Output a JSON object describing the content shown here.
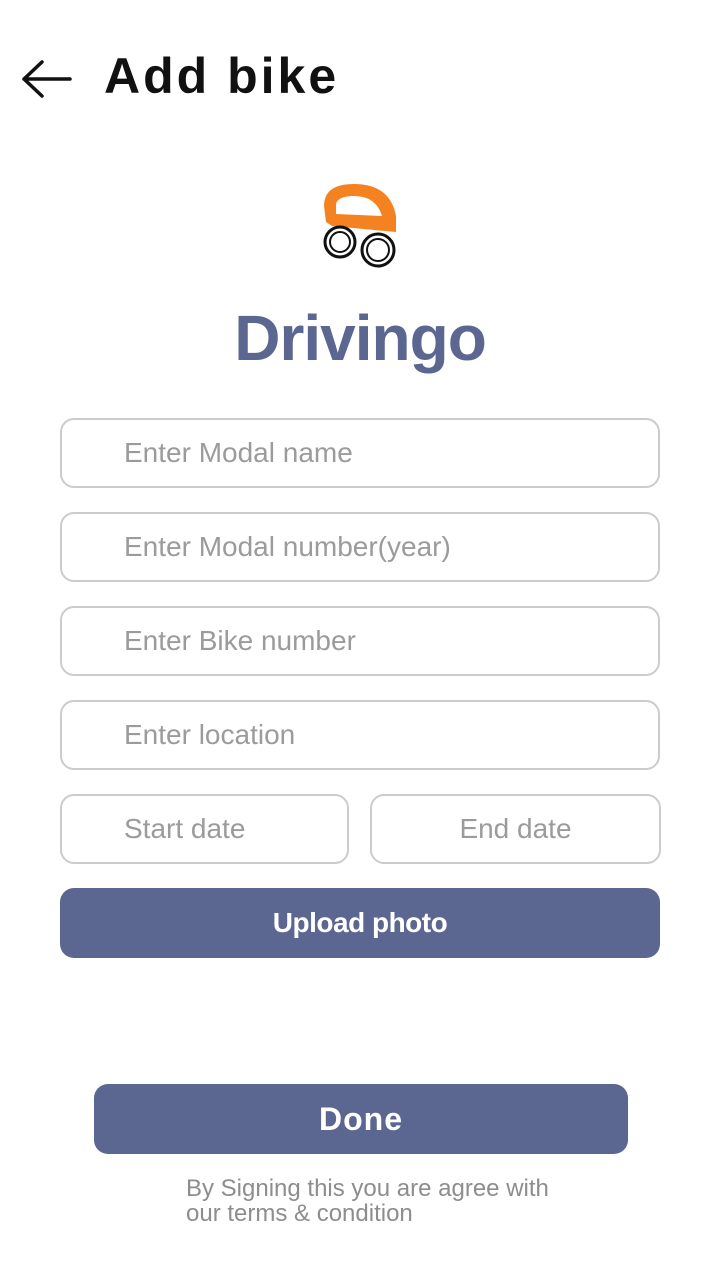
{
  "header": {
    "back_icon": "arrow-left-icon",
    "title": "Add bike"
  },
  "brand": {
    "logo_icon": "car-logo-icon",
    "name": "Drivingo",
    "name_color": "#5b6790",
    "logo_color": "#f58220"
  },
  "form": {
    "model_name_placeholder": "Enter Modal name",
    "model_number_placeholder": "Enter Modal number(year)",
    "bike_number_placeholder": "Enter Bike number",
    "location_placeholder": "Enter location",
    "start_date_placeholder": "Start date",
    "end_date_placeholder": "End date",
    "upload_label": "Upload photo"
  },
  "footer": {
    "done_label": "Done",
    "terms_line1": "By Signing  this you are agree with",
    "terms_line2": "our terms & condition",
    "button_color": "#5b6790"
  }
}
